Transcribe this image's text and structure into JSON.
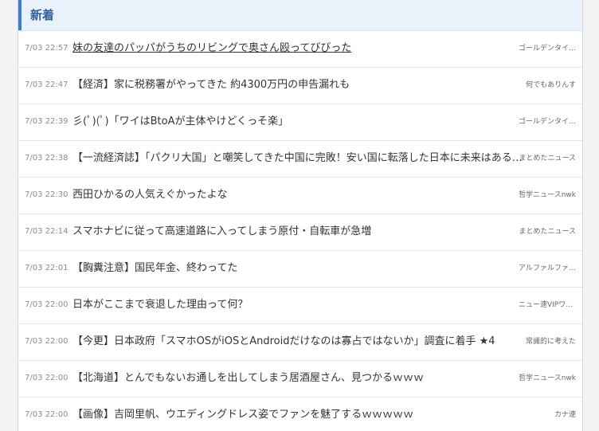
{
  "section": {
    "title": "新着",
    "accent_color": "#3b7ccd",
    "header_bg": "#e9f1fa"
  },
  "articles": [
    {
      "time": "7/03 22:57",
      "title": "妹の友達のパッパがうちのリビングで奥さん殴ってびびった",
      "source": "ゴールデンタイムズ",
      "visited": true
    },
    {
      "time": "7/03 22:47",
      "title": "【経済】家に税務署がやってきた 約4300万円の申告漏れも",
      "source": "何でもありんす",
      "visited": false
    },
    {
      "time": "7/03 22:39",
      "title": "彡(ﾟ)(ﾟ)「ワイはBtoAが主体やけどくっそ楽」",
      "source": "ゴールデンタイムズ",
      "visited": false
    },
    {
      "time": "7/03 22:38",
      "title": "【一流経済誌】「パクリ大国」と嘲笑してきた中国に完敗！安い国に転落した日本に未来はあるのか…",
      "source": "まとめたニュース",
      "visited": false
    },
    {
      "time": "7/03 22:30",
      "title": "西田ひかるの人気えぐかったよな",
      "source": "哲学ニュースnwk",
      "visited": false
    },
    {
      "time": "7/03 22:14",
      "title": "スマホナビに従って高速道路に入ってしまう原付・自転車が急増",
      "source": "まとめたニュース",
      "visited": false
    },
    {
      "time": "7/03 22:01",
      "title": "【胸糞注意】国民年金、終わってた",
      "source": "アルファルファモザ…",
      "visited": false
    },
    {
      "time": "7/03 22:00",
      "title": "日本がここまで衰退した理由って何？",
      "source": "ニュー速VIPワイド",
      "visited": false
    },
    {
      "time": "7/03 22:00",
      "title": "【今更】日本政府「スマホOSがiOSとAndroidだけなのは寡占ではないか」調査に着手 ★4",
      "source": "常識的に考えた",
      "visited": false
    },
    {
      "time": "7/03 22:00",
      "title": "【北海道】とんでもないお通しを出してしまう居酒屋さん、見つかるｗｗｗ",
      "source": "哲学ニュースnwk",
      "visited": false
    },
    {
      "time": "7/03 22:00",
      "title": "【画像】吉岡里帆、ウエディングドレス姿でファンを魅了するｗｗｗｗｗ",
      "source": "カナ速",
      "visited": false
    }
  ]
}
